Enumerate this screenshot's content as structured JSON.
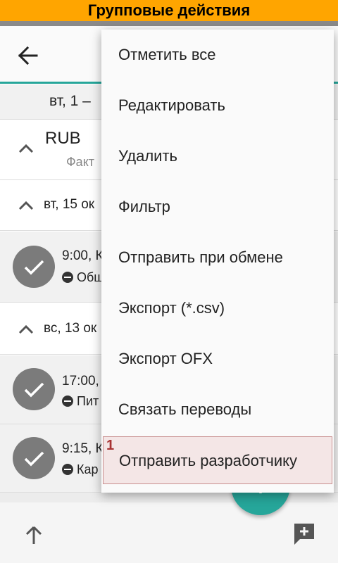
{
  "banner": {
    "title": "Групповые действия"
  },
  "toolbar": {
    "back_icon": "arrow-back-icon"
  },
  "period": {
    "label": "вт, 1 –"
  },
  "currency": {
    "code": "RUB",
    "subtitle": "Факт"
  },
  "groups": [
    {
      "date": "вт, 15 ок",
      "transactions": [
        {
          "time": "9:00, К",
          "category": "Общ"
        }
      ]
    },
    {
      "date": "вс, 13 ок",
      "transactions": [
        {
          "time": "17:00,",
          "category": "Пит"
        },
        {
          "time": "9:15, К",
          "category": "Кар"
        }
      ]
    }
  ],
  "menu": {
    "items": [
      {
        "label": "Отметить все"
      },
      {
        "label": "Редактировать"
      },
      {
        "label": "Удалить"
      },
      {
        "label": "Фильтр"
      },
      {
        "label": "Отправить при обмене"
      },
      {
        "label": "Экспорт (*.csv)"
      },
      {
        "label": "Экспорт OFX"
      },
      {
        "label": "Связать переводы"
      },
      {
        "label": "Отправить разработчику",
        "marker": "1"
      }
    ]
  },
  "bottom_bar": {
    "left_icon": "arrow-up-icon",
    "right_icon": "add-comment-icon"
  },
  "fab": {
    "icon": "plus-icon"
  },
  "colors": {
    "banner": "#ffa500",
    "accent": "#26a69a",
    "check": "#7b7b7b",
    "highlight": "#f4e6e6"
  }
}
